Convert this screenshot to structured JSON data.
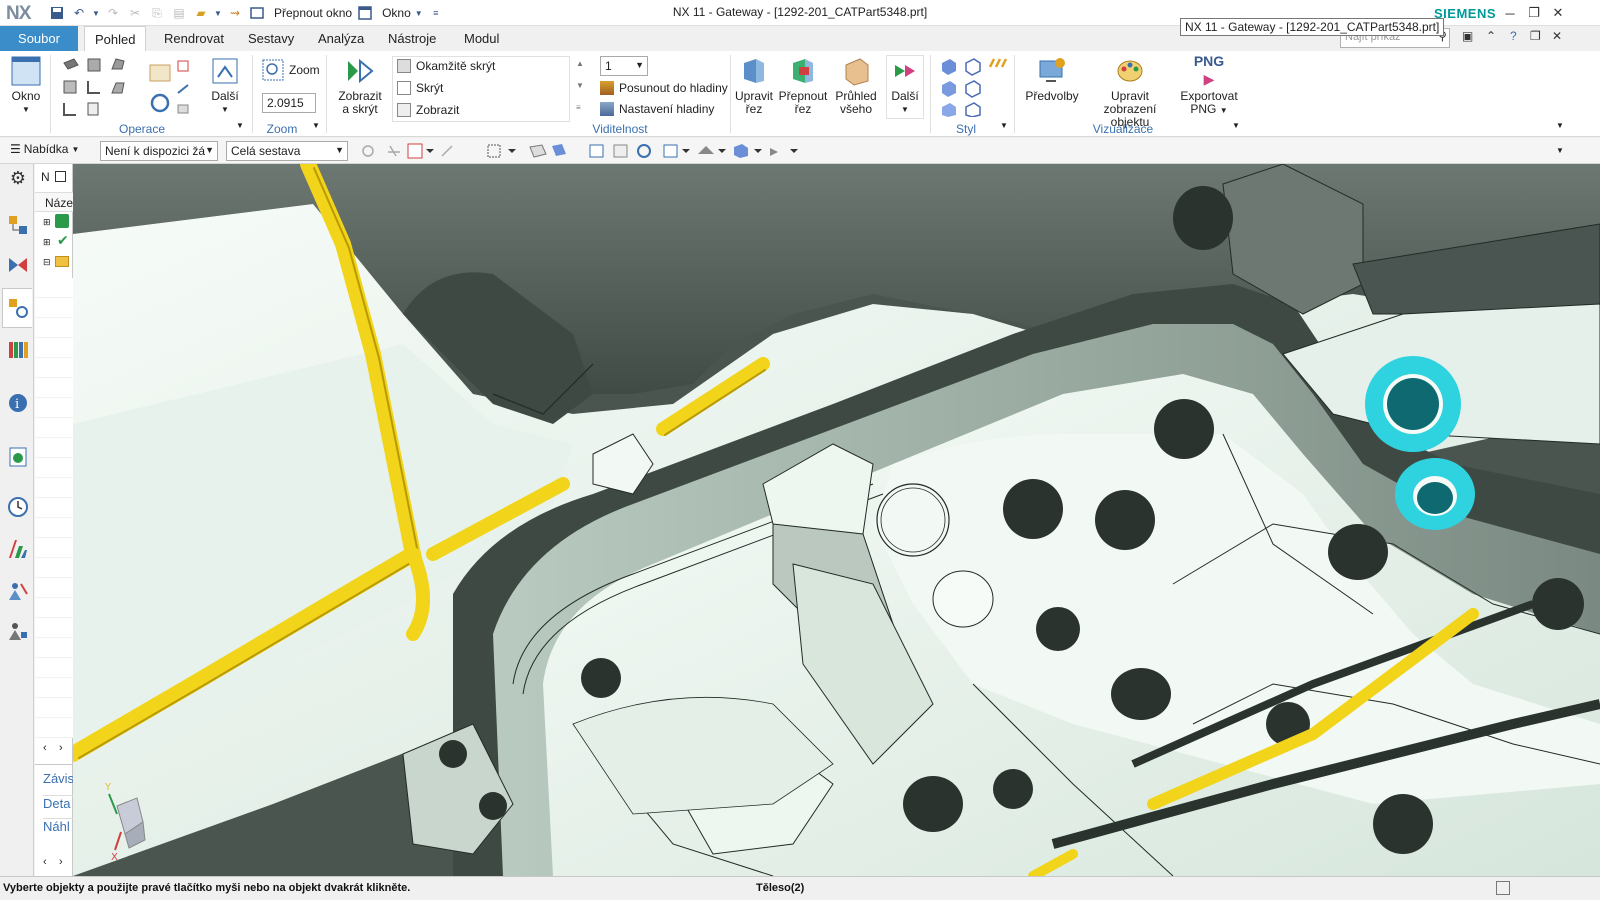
{
  "app": {
    "logo": "NX",
    "title": "NX 11 - Gateway - [1292-201_CATPart5348.prt]",
    "tooltip": "NX 11 - Gateway - [1292-201_CATPart5348.prt]",
    "brand": "SIEMENS",
    "brand_color": "#009999"
  },
  "quick_access": {
    "switch_window": "Přepnout okno",
    "window": "Okno"
  },
  "tabs": {
    "file": "Soubor",
    "items": [
      "Pohled",
      "Rendrovat",
      "Sestavy",
      "Analýza",
      "Nástroje",
      "Modul"
    ],
    "active_index": 0,
    "search_placeholder": "Najít příkaz"
  },
  "ribbon": {
    "okno": "Okno",
    "dalsi1": "Další",
    "operace": "Operace",
    "zoom_label": "Zoom",
    "zoom_value": "2.0915",
    "zoom_group": "Zoom",
    "zobrazit_skryt": [
      "Zobrazit",
      "a skrýt"
    ],
    "okamzite_skryt": "Okamžitě skrýt",
    "skryt": "Skrýt",
    "zobrazit": "Zobrazit",
    "layer_value": "1",
    "posunout": "Posunout do hladiny",
    "nastaveni": "Nastavení hladiny",
    "viditelnost": "Viditelnost",
    "upravit_rez": [
      "Upravit",
      "řez"
    ],
    "prepnout_rez": [
      "Přepnout",
      "řez"
    ],
    "pruhled": [
      "Průhled",
      "všeho"
    ],
    "dalsi2": "Další",
    "styl": "Styl",
    "predvolby": "Předvolby",
    "upravit_zobrazeni": [
      "Upravit zobrazení",
      "objektu"
    ],
    "exportovat": [
      "Exportovat",
      "PNG"
    ],
    "png": "PNG",
    "vizualizace": "Vizualizace"
  },
  "toolbar2": {
    "nabidka": "Nabídka",
    "filter1": "Není k dispozici žá",
    "filter2": "Celá sestava"
  },
  "navpanel": {
    "title_char": "N",
    "name_header": "Náze",
    "bottom_items": [
      "Závis",
      "Deta",
      "Náhl"
    ]
  },
  "status": {
    "message": "Vyberte objekty a použijte pravé tlačítko myši nebo na objekt dvakrát klikněte.",
    "selection": "Těleso(2)"
  },
  "colors": {
    "accent": "#3a8dc8",
    "highlight_yellow": "#f2d41a",
    "highlight_cyan": "#2fd3e0",
    "model_light": "#e6f2ea",
    "model_dark": "#4b5550"
  }
}
